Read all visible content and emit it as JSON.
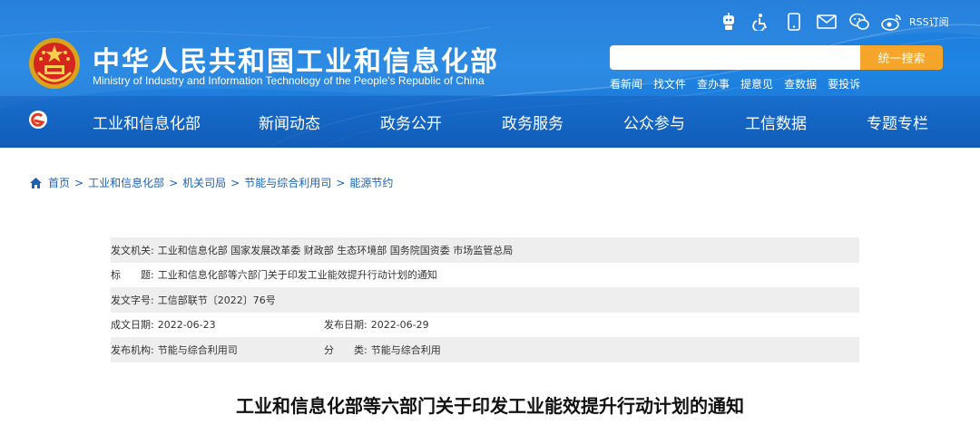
{
  "header": {
    "title": "中华人民共和国工业和信息化部",
    "subtitle": "Ministry of Industry and Information Technology of the People's Republic of China",
    "tools": [
      {
        "name": "robot-assistant-icon"
      },
      {
        "name": "accessibility-icon"
      },
      {
        "name": "mobile-icon"
      },
      {
        "name": "mail-icon"
      },
      {
        "name": "wechat-icon"
      },
      {
        "name": "weibo-icon"
      }
    ],
    "rss_label": "RSS订阅",
    "search": {
      "placeholder": "",
      "button_label": "统一搜索"
    },
    "quick_links": [
      "看新闻",
      "找文件",
      "查办事",
      "提意见",
      "查数据",
      "要投诉"
    ],
    "nav": [
      "工业和信息化部",
      "新闻动态",
      "政务公开",
      "政务服务",
      "公众参与",
      "工信数据",
      "专题专栏"
    ],
    "colors": {
      "primary": "#1f84e3",
      "accent": "#f4a52a"
    }
  },
  "breadcrumb": [
    "首页",
    "工业和信息化部",
    "机关司局",
    "节能与综合利用司",
    "能源节约"
  ],
  "meta": {
    "issuer_label": "发文机关:",
    "issuer_value": "工业和信息化部 国家发展改革委 财政部 生态环境部 国务院国资委 市场监管总局",
    "title_label": "标　　题:",
    "title_value": "工业和信息化部等六部门关于印发工业能效提升行动计划的通知",
    "docno_label": "发文字号:",
    "docno_value": "工信部联节〔2022〕76号",
    "date_label": "成文日期:",
    "date_value": "2022-06-23",
    "pubdate_label": "发布日期:",
    "pubdate_value": "2022-06-29",
    "org_label": "发布机构:",
    "org_value": "节能与综合利用司",
    "category_label": "分　　类:",
    "category_value": "节能与综合利用"
  },
  "article": {
    "title": "工业和信息化部等六部门关于印发工业能效提升行动计划的通知"
  }
}
